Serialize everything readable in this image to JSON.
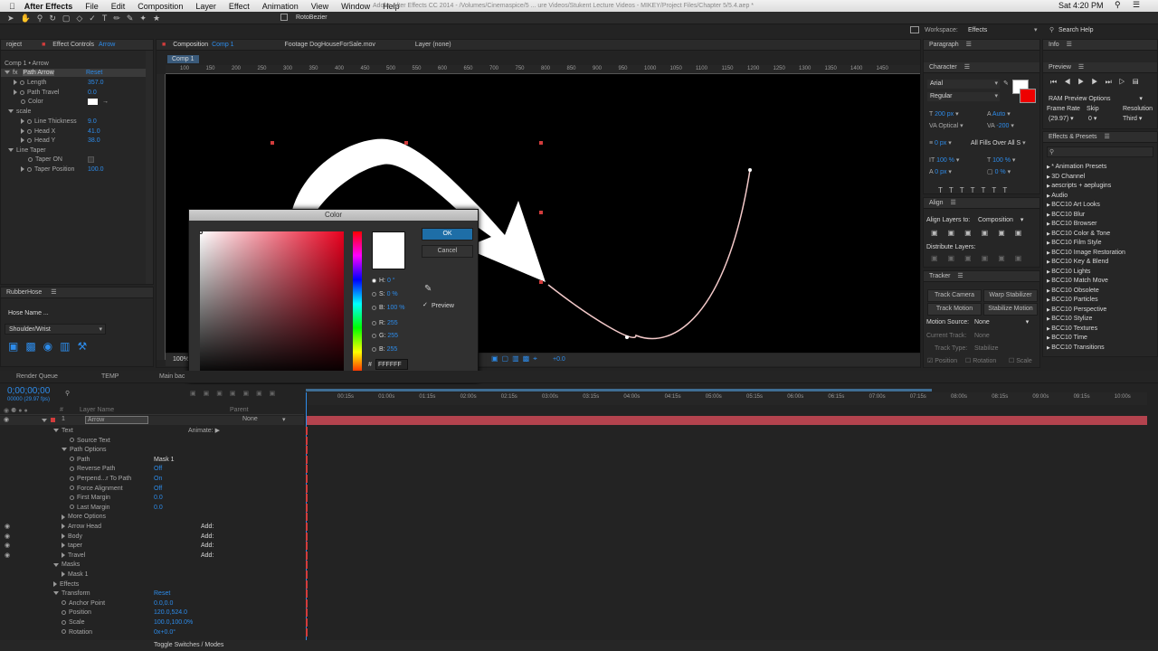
{
  "menubar": {
    "app": "After Effects",
    "items": [
      "File",
      "Edit",
      "Composition",
      "Layer",
      "Effect",
      "Animation",
      "View",
      "Window",
      "Help"
    ],
    "title": "Adobe After Effects CC 2014 - /Volumes/Cinemaspice/5 ... ure Videos/Stukent Lecture Videos - MIKEY/Project Files/Chapter 5/5.4.aep *",
    "clock": "Sat 4:20 PM"
  },
  "toolbar": {
    "label": "RotoBezier",
    "workspace_label": "Workspace:",
    "workspace_value": "Effects",
    "search_help": "Search Help"
  },
  "effect_controls": {
    "tab_project": "roject",
    "tab_effect": "Effect Controls",
    "tab_effect_layer": "Arrow",
    "breadcrumb": "Comp 1 • Arrow",
    "fx_name": "Path Arrow",
    "reset": "Reset",
    "rows": [
      {
        "label": "Length",
        "value": "357.0"
      },
      {
        "label": "Path Travel",
        "value": "0.0"
      },
      {
        "label": "Color",
        "value": ""
      },
      {
        "label": "scale",
        "value": ""
      },
      {
        "label": "Line Thickness",
        "value": "9.0"
      },
      {
        "label": "Head X",
        "value": "41.0"
      },
      {
        "label": "Head Y",
        "value": "38.0"
      },
      {
        "label": "Line Taper",
        "value": ""
      },
      {
        "label": "Taper ON",
        "value": ""
      },
      {
        "label": "Taper Position",
        "value": "100.0"
      }
    ]
  },
  "rubberhose": {
    "tab": "RubberHose",
    "name_label": "Hose Name ...",
    "dropdown": "Shoulder/Wrist"
  },
  "comp_panel": {
    "tab_comp": "Composition",
    "tab_comp_name": "Comp 1",
    "tab_footage": "Footage DogHouseForSale.mov",
    "tab_layer": "Layer (none)",
    "comp_chip": "Comp 1",
    "ruler": [
      "100",
      "150",
      "200",
      "250",
      "300",
      "350",
      "400",
      "450",
      "500",
      "550",
      "600",
      "650",
      "700",
      "750",
      "800",
      "850",
      "900",
      "950",
      "1000",
      "1050",
      "1100",
      "1150",
      "1200",
      "1250",
      "1300",
      "1350",
      "1400",
      "1450"
    ],
    "zoom": "100%",
    "offset": "+0.0"
  },
  "color_dialog": {
    "title": "Color",
    "ok": "OK",
    "cancel": "Cancel",
    "preview": "Preview",
    "fields": [
      {
        "label": "H:",
        "value": "0 °"
      },
      {
        "label": "S:",
        "value": "0 %"
      },
      {
        "label": "B:",
        "value": "100 %"
      },
      {
        "label": "R:",
        "value": "255"
      },
      {
        "label": "G:",
        "value": "255"
      },
      {
        "label": "B:",
        "value": "255"
      }
    ],
    "hash": "#",
    "hex": "FFFFFF",
    "current_color": "#FFFFFF"
  },
  "right_panels": {
    "paragraph": "Paragraph",
    "info": "Info",
    "character": "Character",
    "font": "Arial",
    "style": "Regular",
    "size": "200 px",
    "leading": "Auto",
    "kerning": "Optical",
    "tracking": "-200",
    "stroke": "0 px",
    "stroke_mode": "All Fills Over All S",
    "vscale": "100 %",
    "hscale": "100 %",
    "baseline": "0 px",
    "tsume": "0 %",
    "align": "Align",
    "align_to_label": "Align Layers to:",
    "align_to": "Composition",
    "distribute": "Distribute Layers:",
    "tracker": "Tracker",
    "track_camera": "Track Camera",
    "warp_stabilizer": "Warp Stabilizer",
    "track_motion": "Track Motion",
    "stabilize_motion": "Stabilize Motion",
    "motion_source_label": "Motion Source:",
    "motion_source": "None",
    "current_track_label": "Current Track:",
    "current_track": "None",
    "track_type_label": "Track Type:",
    "track_type": "Stabilize",
    "position": "Position",
    "rotation": "Rotation",
    "scale": "Scale",
    "preview": "Preview",
    "ram_preview": "RAM Preview Options",
    "frame_rate_label": "Frame Rate",
    "skip_label": "Skip",
    "resolution_label": "Resolution",
    "frame_rate": "(29.97)",
    "skip": "0",
    "resolution": "Third",
    "effects_presets": "Effects & Presets",
    "presets": [
      "* Animation Presets",
      "3D Channel",
      "aescripts + aeplugins",
      "Audio",
      "BCC10 Art Looks",
      "BCC10 Blur",
      "BCC10 Browser",
      "BCC10 Color & Tone",
      "BCC10 Film Style",
      "BCC10 Image Restoration",
      "BCC10 Key & Blend",
      "BCC10 Lights",
      "BCC10 Match Move",
      "BCC10 Obsolete",
      "BCC10 Particles",
      "BCC10 Perspective",
      "BCC10 Stylize",
      "BCC10 Textures",
      "BCC10 Time",
      "BCC10 Transitions"
    ]
  },
  "timeline": {
    "tabs": [
      "Render Queue",
      "TEMP",
      "Main bac"
    ],
    "timecode": "0;00;00;00",
    "frames": "00000 (29.97 fps)",
    "col_layer": "Layer Name",
    "col_parent": "Parent",
    "layer_num": "1",
    "layer_name": "Arrow",
    "parent": "None",
    "animate": "Animate:",
    "ticks": [
      "00:15s",
      "01:00s",
      "01:15s",
      "02:00s",
      "02:15s",
      "03:00s",
      "03:15s",
      "04:00s",
      "04:15s",
      "05:00s",
      "05:15s",
      "06:00s",
      "06:15s",
      "07:00s",
      "07:15s",
      "08:00s",
      "08:15s",
      "09:00s",
      "09:15s",
      "10:00s"
    ],
    "rows": [
      {
        "label": "Text",
        "value": "",
        "indent": 1,
        "tri": "down"
      },
      {
        "label": "Source Text",
        "value": "",
        "indent": 3,
        "tri": ""
      },
      {
        "label": "Path Options",
        "value": "",
        "indent": 2,
        "tri": "down"
      },
      {
        "label": "Path",
        "value": "Mask 1",
        "indent": 3,
        "tri": ""
      },
      {
        "label": "Reverse Path",
        "value": "Off",
        "indent": 3,
        "tri": ""
      },
      {
        "label": "Perpend...r To Path",
        "value": "On",
        "indent": 3,
        "tri": ""
      },
      {
        "label": "Force Alignment",
        "value": "Off",
        "indent": 3,
        "tri": ""
      },
      {
        "label": "First Margin",
        "value": "0.0",
        "indent": 3,
        "tri": ""
      },
      {
        "label": "Last Margin",
        "value": "0.0",
        "indent": 3,
        "tri": ""
      },
      {
        "label": "More Options",
        "value": "",
        "indent": 2,
        "tri": "right"
      },
      {
        "label": "Arrow Head",
        "value": "Add:",
        "indent": 2,
        "tri": "right"
      },
      {
        "label": "Body",
        "value": "Add:",
        "indent": 2,
        "tri": "right"
      },
      {
        "label": "taper",
        "value": "Add:",
        "indent": 2,
        "tri": "right"
      },
      {
        "label": "Travel",
        "value": "Add:",
        "indent": 2,
        "tri": "right"
      },
      {
        "label": "Masks",
        "value": "",
        "indent": 1,
        "tri": "down"
      },
      {
        "label": "Mask 1",
        "value": "",
        "indent": 2,
        "tri": "right"
      },
      {
        "label": "Effects",
        "value": "",
        "indent": 1,
        "tri": "right"
      },
      {
        "label": "Transform",
        "value": "Reset",
        "indent": 1,
        "tri": "down"
      },
      {
        "label": "Anchor Point",
        "value": "0.0,0.0",
        "indent": 2,
        "tri": ""
      },
      {
        "label": "Position",
        "value": "120.0,524.0",
        "indent": 2,
        "tri": ""
      },
      {
        "label": "Scale",
        "value": "100.0,100.0%",
        "indent": 2,
        "tri": ""
      },
      {
        "label": "Rotation",
        "value": "0x+0.0°",
        "indent": 2,
        "tri": ""
      }
    ],
    "toggle": "Toggle Switches / Modes"
  }
}
